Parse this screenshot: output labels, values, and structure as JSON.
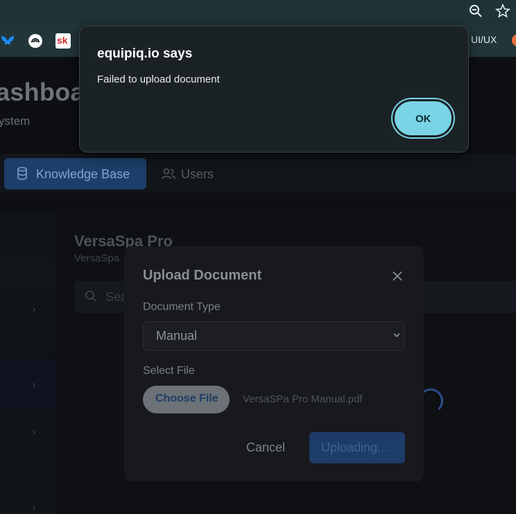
{
  "browser": {
    "bookmark_label": "UI/UX",
    "bookmark_sk": "sk"
  },
  "dialog": {
    "title": "equipiq.io says",
    "message": "Failed to upload document",
    "ok_label": "OK"
  },
  "page": {
    "title_fragment": "ashboa",
    "subtitle_fragment": "ystem",
    "tabs": [
      {
        "label": "Knowledge Base",
        "icon": "database-icon",
        "active": true
      },
      {
        "label": "Users",
        "icon": "users-icon",
        "active": false
      }
    ],
    "product_title": "VersaSpa Pro",
    "product_subtitle_fragment": "VersaSpa",
    "search_placeholder_fragment": "Sea"
  },
  "upload_modal": {
    "title": "Upload Document",
    "document_type_label": "Document Type",
    "document_type_value": "Manual",
    "select_file_label": "Select File",
    "choose_file_label": "Choose File",
    "file_name": "VersaSPa Pro Manual.pdf",
    "cancel_label": "Cancel",
    "uploading_label": "Uploading..."
  },
  "colors": {
    "accent": "#79d4e6",
    "primary": "#1e3c68"
  }
}
